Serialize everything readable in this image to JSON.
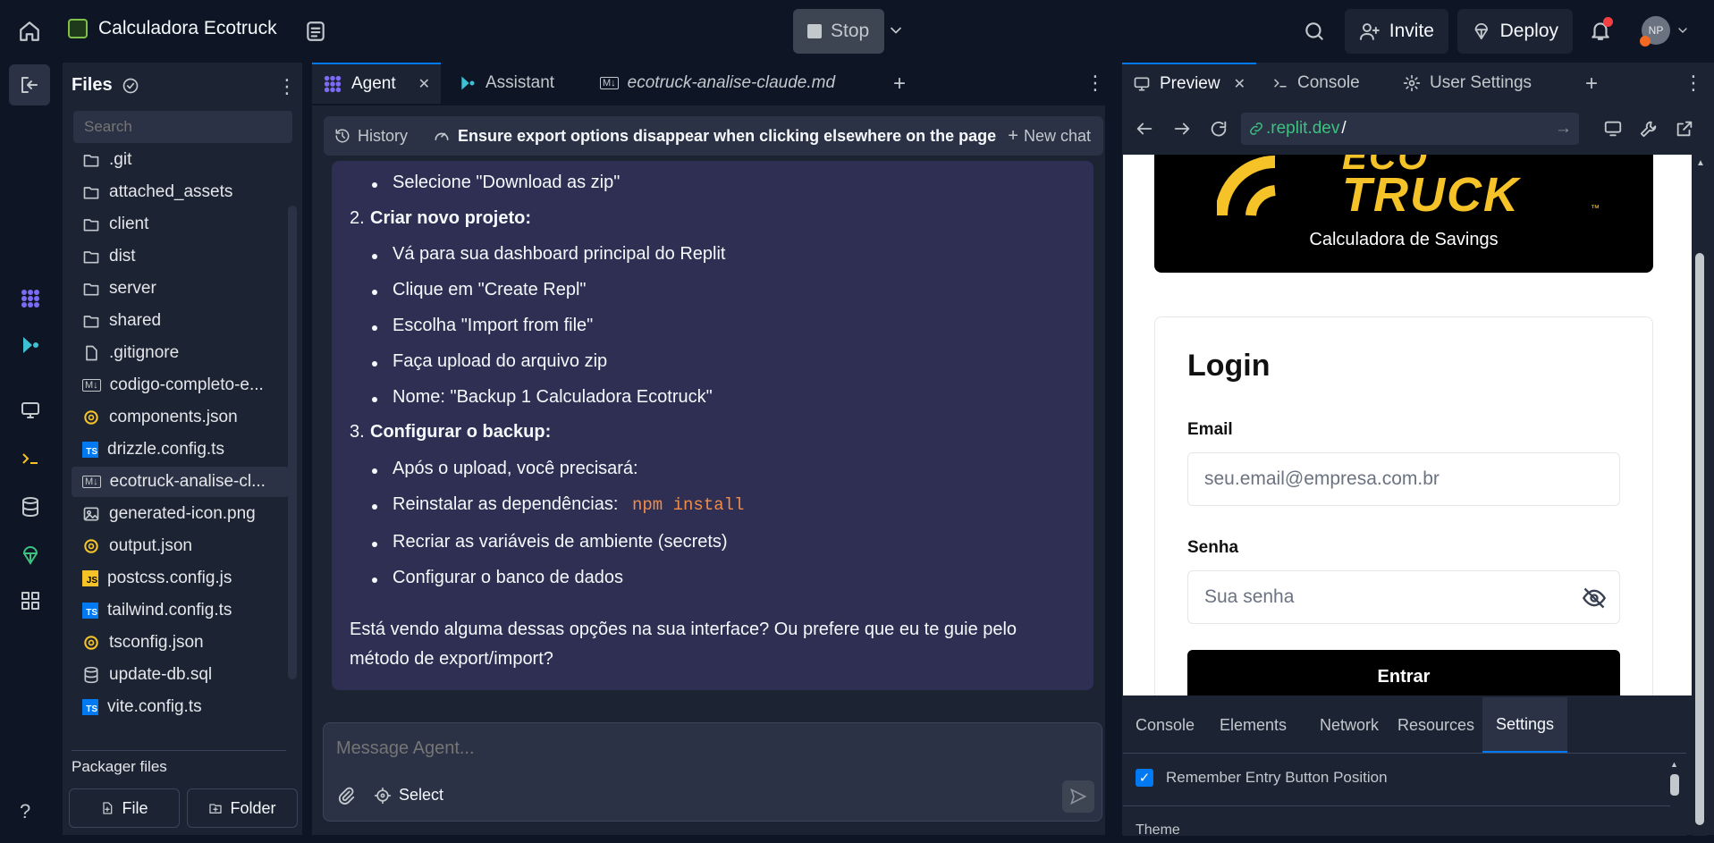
{
  "topbar": {
    "project_name": "Calculadora Ecotruck",
    "stop_label": "Stop",
    "invite_label": "Invite",
    "deploy_label": "Deploy",
    "avatar_initials": "NP"
  },
  "files": {
    "title": "Files",
    "search_placeholder": "Search",
    "items": [
      {
        "label": ".git",
        "icon": "folder-icon"
      },
      {
        "label": "attached_assets",
        "icon": "folder-icon"
      },
      {
        "label": "client",
        "icon": "folder-icon"
      },
      {
        "label": "dist",
        "icon": "folder-icon"
      },
      {
        "label": "server",
        "icon": "folder-icon"
      },
      {
        "label": "shared",
        "icon": "folder-icon"
      },
      {
        "label": ".gitignore",
        "icon": "file-icon"
      },
      {
        "label": "codigo-completo-e...",
        "icon": "markdown-icon"
      },
      {
        "label": "components.json",
        "icon": "json-icon"
      },
      {
        "label": "drizzle.config.ts",
        "icon": "ts-icon"
      },
      {
        "label": "ecotruck-analise-cl...",
        "icon": "markdown-icon"
      },
      {
        "label": "generated-icon.png",
        "icon": "image-icon"
      },
      {
        "label": "output.json",
        "icon": "json-icon"
      },
      {
        "label": "postcss.config.js",
        "icon": "js-icon"
      },
      {
        "label": "tailwind.config.ts",
        "icon": "ts-icon"
      },
      {
        "label": "tsconfig.json",
        "icon": "json-icon"
      },
      {
        "label": "update-db.sql",
        "icon": "database-icon"
      },
      {
        "label": "vite.config.ts",
        "icon": "ts-icon"
      }
    ],
    "packager_label": "Packager files",
    "new_file_label": "File",
    "new_folder_label": "Folder"
  },
  "tabs": {
    "agent": "Agent",
    "assistant": "Assistant",
    "md_file": "ecotruck-analise-claude.md"
  },
  "chat": {
    "history_label": "History",
    "thread_title": "Ensure export options disappear when clicking elsewhere on the page",
    "new_chat_label": "New chat",
    "lines": {
      "b0": "Selecione \"Download as zip\"",
      "n2_num": "2.",
      "n2": "Criar novo projeto:",
      "b1": "Vá para sua dashboard principal do Replit",
      "b2": "Clique em \"Create Repl\"",
      "b3": "Escolha \"Import from file\"",
      "b4": "Faça upload do arquivo zip",
      "b5": "Nome: \"Backup 1 Calculadora Ecotruck\"",
      "n3_num": "3.",
      "n3": "Configurar o backup:",
      "b6": "Após o upload, você precisará:",
      "b7": "Reinstalar as dependências:",
      "b7_code": "npm install",
      "b8": "Recriar as variáveis de ambiente (secrets)",
      "b9": "Configurar o banco de dados",
      "p1": "Está vendo alguma dessas opções na sua interface? Ou prefere que eu te guie pelo",
      "p2": "método de export/import?"
    },
    "input_placeholder": "Message Agent...",
    "select_label": "Select"
  },
  "preview": {
    "tabs": {
      "preview": "Preview",
      "console": "Console",
      "settings": "User Settings"
    },
    "url_host": ".replit.dev",
    "url_path": "/",
    "logo_top": "ECO",
    "logo_bottom": "TRUCK",
    "logo_tm": "™",
    "subtitle": "Calculadora de Savings",
    "login_title": "Login",
    "email_label": "Email",
    "email_placeholder": "seu.email@empresa.com.br",
    "password_label": "Senha",
    "password_placeholder": "Sua senha",
    "submit_label": "Entrar"
  },
  "devtools": {
    "tabs": [
      "Console",
      "Elements",
      "Network",
      "Resources",
      "Settings"
    ],
    "active_tab": "Settings",
    "remember_label": "Remember Entry Button Position",
    "remember_checked": true,
    "theme_label": "Theme"
  },
  "colors": {
    "accent_blue": "#0079f2",
    "agent_purple": "#7c6bf5",
    "code_orange": "#f08c4a",
    "logo_yellow": "#f5c228"
  }
}
